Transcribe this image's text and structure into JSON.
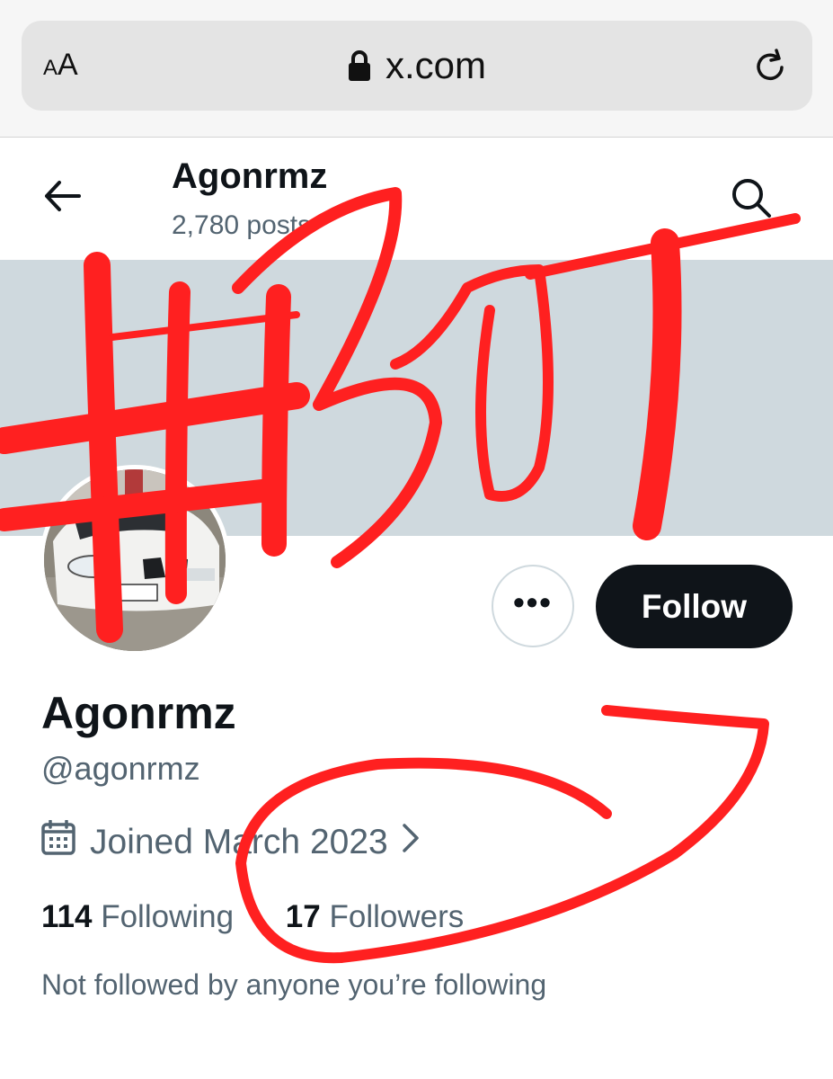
{
  "browser": {
    "text_size_label_small": "A",
    "text_size_label_large": "A",
    "url": "x.com"
  },
  "header": {
    "name": "Agonrmz",
    "post_count": "2,780 posts"
  },
  "profile": {
    "display_name": "Agonrmz",
    "handle": "@agonrmz",
    "joined": "Joined March 2023",
    "following_count": "114",
    "following_label": "Following",
    "followers_count": "17",
    "followers_label": "Followers",
    "not_followed_text": "Not followed by anyone you’re following"
  },
  "actions": {
    "more_label": "•••",
    "follow_label": "Follow"
  },
  "colors": {
    "banner": "#cfd9de",
    "follow_button_bg": "#0f1419",
    "secondary_text": "#536471",
    "annotation_red": "#ff2020"
  },
  "annotation": {
    "handwritten_text": "#BOT"
  }
}
